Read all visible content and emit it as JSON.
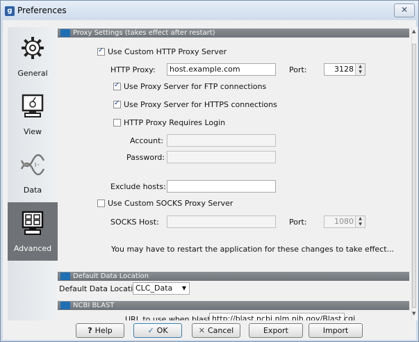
{
  "window": {
    "title": "Preferences",
    "app_icon_letter": "g",
    "close_glyph": "✕"
  },
  "sidebar": {
    "items": [
      {
        "label": "General",
        "icon": "gear-icon"
      },
      {
        "label": "View",
        "icon": "monitor-icon"
      },
      {
        "label": "Data",
        "icon": "dna-icon"
      },
      {
        "label": "Advanced",
        "icon": "advanced-monitor-icon",
        "selected": true
      }
    ]
  },
  "proxy": {
    "header": "Proxy Settings (takes effect after restart)",
    "use_http_proxy": {
      "label": "Use Custom HTTP Proxy Server",
      "checked": true
    },
    "http_proxy_label": "HTTP Proxy:",
    "http_proxy_value": "host.example.com",
    "port_label": "Port:",
    "port_value": "3128",
    "ftp": {
      "label": "Use Proxy Server for FTP connections",
      "checked": true
    },
    "https": {
      "label": "Use Proxy Server for HTTPS connections",
      "checked": true
    },
    "requires_login": {
      "label": "HTTP Proxy Requires Login",
      "checked": false
    },
    "account_label": "Account:",
    "password_label": "Password:",
    "exclude_label": "Exclude hosts:",
    "use_socks": {
      "label": "Use Custom SOCKS Proxy Server",
      "checked": false
    },
    "socks_host_label": "SOCKS Host:",
    "socks_port_label": "Port:",
    "socks_port_value": "1080",
    "restart_note": "You may have to restart the application for these changes to take effect..."
  },
  "data_location": {
    "header": "Default Data Location",
    "label": "Default Data Location:",
    "value": "CLC_Data"
  },
  "blast": {
    "header": "NCBI BLAST",
    "url_label": "URL to use when blasting:",
    "url_value": "http://blast.ncbi.nlm.nih.gov/Blast.cgi"
  },
  "buttons": {
    "help": "Help",
    "ok": "OK",
    "cancel": "Cancel",
    "export": "Export",
    "import": "Import"
  }
}
